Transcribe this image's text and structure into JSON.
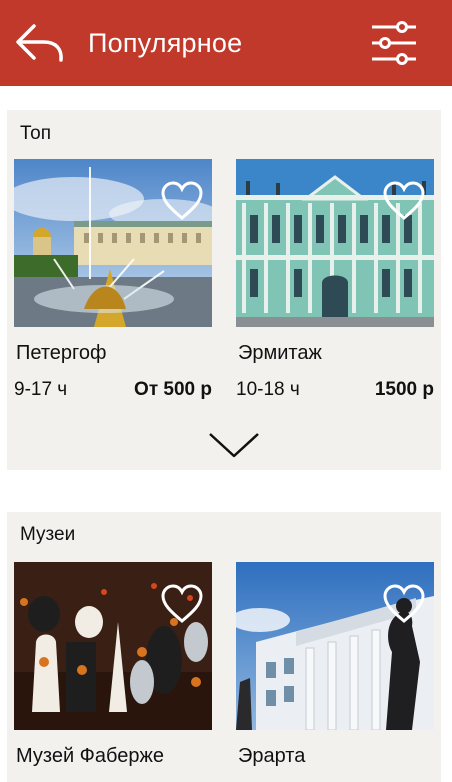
{
  "header": {
    "title": "Популярное",
    "back_icon": "back-arrow-icon",
    "filter_icon": "filter-sliders-icon",
    "color": "#c0392b"
  },
  "sections": [
    {
      "heading": "Топ",
      "cards": [
        {
          "name": "Петергоф",
          "hours": "9-17 ч",
          "price": "От 500 р",
          "favorite_icon": "heart-outline-icon"
        },
        {
          "name": "Эрмитаж",
          "hours": "10-18 ч",
          "price": "1500 р",
          "favorite_icon": "heart-outline-icon"
        }
      ],
      "expand_icon": "chevron-down-icon"
    },
    {
      "heading": "Музеи",
      "cards": [
        {
          "name": "Музей Фаберже",
          "favorite_icon": "heart-outline-icon"
        },
        {
          "name": "Эрарта",
          "favorite_icon": "heart-outline-icon"
        }
      ]
    }
  ]
}
